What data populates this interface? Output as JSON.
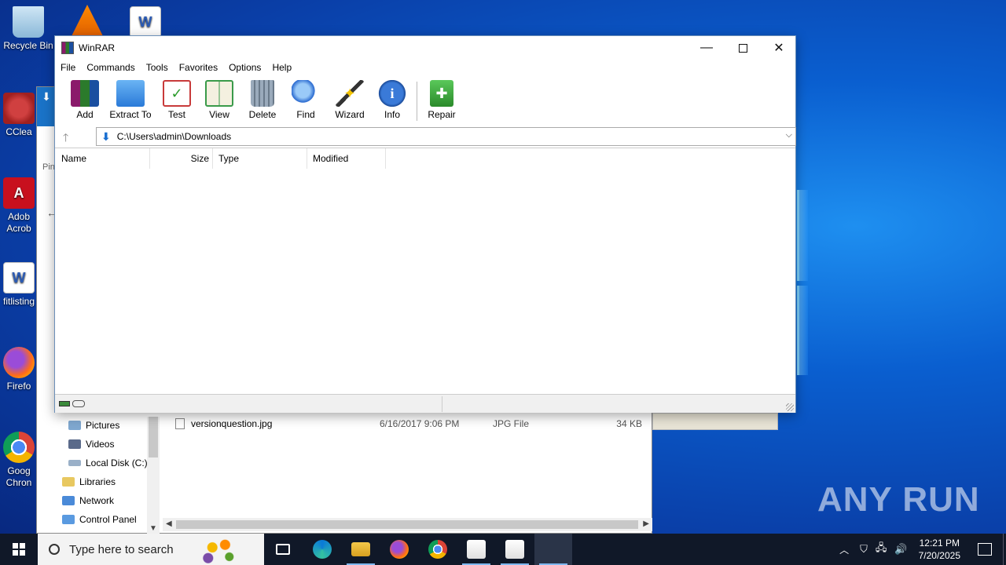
{
  "desktop": {
    "icons": [
      {
        "label": "Recycle Bin",
        "icon": "recycle-bin-icon"
      },
      {
        "label": "",
        "icon": "vlc-icon"
      },
      {
        "label": "",
        "icon": "word-doc-icon"
      },
      {
        "label": "CClea",
        "icon": "ccleaner-icon"
      },
      {
        "label": "Adob",
        "label2": "Acrob",
        "icon": "adobe-acrobat-icon"
      },
      {
        "label": "fitlisting",
        "icon": "word-doc-icon"
      },
      {
        "label": "Firefo",
        "icon": "firefox-icon"
      },
      {
        "label": "Goog",
        "label2": "Chron",
        "icon": "chrome-icon"
      }
    ],
    "watermark": "ANY RUN"
  },
  "explorer": {
    "pin_label": "Pin",
    "nav_items": [
      {
        "label": "Pictures",
        "icon": "pictures-folder-icon"
      },
      {
        "label": "Videos",
        "icon": "videos-folder-icon"
      },
      {
        "label": "Local Disk (C:)",
        "icon": "drive-icon"
      },
      {
        "label": "Libraries",
        "icon": "libraries-icon"
      },
      {
        "label": "Network",
        "icon": "network-icon"
      },
      {
        "label": "Control Panel",
        "icon": "control-panel-icon"
      }
    ],
    "file": {
      "name": "versionquestion.jpg",
      "modified": "6/16/2017 9:06 PM",
      "type": "JPG File",
      "size": "34 KB"
    }
  },
  "winrar": {
    "title": "WinRAR",
    "menu": [
      "File",
      "Commands",
      "Tools",
      "Favorites",
      "Options",
      "Help"
    ],
    "toolbar": [
      {
        "label": "Add",
        "icon": "add-archive-icon",
        "color": "#8b1a6b"
      },
      {
        "label": "Extract To",
        "icon": "extract-folder-icon",
        "color": "#3a8ee8"
      },
      {
        "label": "Test",
        "icon": "test-clipboard-icon",
        "color": "#c83a3a"
      },
      {
        "label": "View",
        "icon": "view-book-icon",
        "color": "#3a9a4a"
      },
      {
        "label": "Delete",
        "icon": "delete-trash-icon",
        "color": "#8a9aaa"
      },
      {
        "label": "Find",
        "icon": "find-magnifier-icon",
        "color": "#2a6ad0"
      },
      {
        "label": "Wizard",
        "icon": "wizard-wand-icon",
        "color": "#e0e0e0"
      },
      {
        "label": "Info",
        "icon": "info-icon",
        "color": "#1a5ab8"
      },
      {
        "label": "Repair",
        "icon": "repair-kit-icon",
        "color": "#3aa83a"
      }
    ],
    "address": "C:\\Users\\admin\\Downloads",
    "columns": [
      "Name",
      "Size",
      "Type",
      "Modified"
    ]
  },
  "taskbar": {
    "search_placeholder": "Type here to search",
    "time": "12:21 PM",
    "date": "7/20/2025"
  }
}
